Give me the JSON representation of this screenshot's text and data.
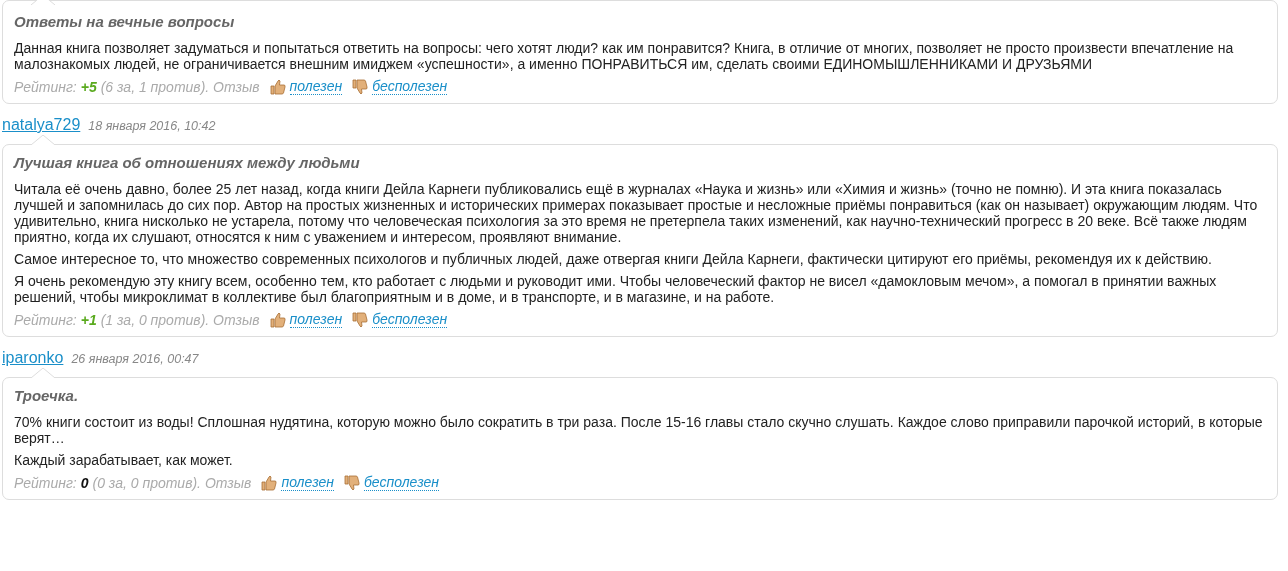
{
  "reviews": [
    {
      "title": "Ответы на вечные вопросы",
      "paragraphs": [
        "Данная книга позволяет задуматься и попытаться ответить на вопросы: чего хотят люди? как им понравится? Книга, в отличие от многих, позволяет не просто произвести впечатление на малознакомых людей, не ограничивается внешним имиджем «успешности», а именно ПОНРАВИТЬСЯ им, сделать своими ЕДИНОМЫШЛЕННИКАМИ И ДРУЗЬЯМИ"
      ],
      "rating": {
        "label": "Рейтинг:",
        "value": "+5",
        "kind": "positive",
        "votes": "(6 за, 1 против). Отзыв",
        "useful": "полезен",
        "useless": "бесполезен"
      }
    },
    {
      "author": "natalya729",
      "date": "18 января 2016, 10:42",
      "title": "Лучшая книга об отношениях между людьми",
      "paragraphs": [
        "Читала её очень давно, более 25 лет назад, когда книги Дейла Карнеги публиковались ещё в журналах «Наука и жизнь» или «Химия и жизнь» (точно не помню). И эта книга показалась лучшей и запомнилась до сих пор. Автор на простых жизненных и исторических примерах показывает простые и несложные приёмы понравиться (как он называет) окружающим людям. Что удивительно, книга нисколько не устарела, потому что человеческая психология за это время не претерпела таких изменений, как научно-технический прогресс в 20 веке. Всё также людям приятно, когда их слушают, относятся к ним с уважением и интересом, проявляют внимание.",
        "Самое интересное то, что множество современных психологов и публичных людей, даже отвергая книги Дейла Карнеги, фактически цитируют его приёмы, рекомендуя их к действию.",
        "Я очень рекомендую эту книгу всем, особенно тем, кто работает с людьми и руководит ими. Чтобы человеческий фактор не висел «дамокловым мечом», а помогал в принятии важных решений, чтобы микроклимат в коллективе был благоприятным и в доме, и в транспорте, и в магазине, и на работе."
      ],
      "rating": {
        "label": "Рейтинг:",
        "value": "+1",
        "kind": "positive",
        "votes": "(1 за, 0 против). Отзыв",
        "useful": "полезен",
        "useless": "бесполезен"
      }
    },
    {
      "author": "iparonko",
      "date": "26 января 2016, 00:47",
      "title": "Троечка.",
      "paragraphs": [
        "70% книги состоит из воды! Сплошная нудятина, которую можно было сократить в три раза. После 15-16 главы стало скучно слушать. Каждое слово приправили парочкой историй, в которые верят…",
        "Каждый зарабатывает, как может."
      ],
      "rating": {
        "label": "Рейтинг:",
        "value": "0",
        "kind": "neutral",
        "votes": "(0 за, 0 против). Отзыв",
        "useful": "полезен",
        "useless": "бесполезен"
      }
    }
  ]
}
